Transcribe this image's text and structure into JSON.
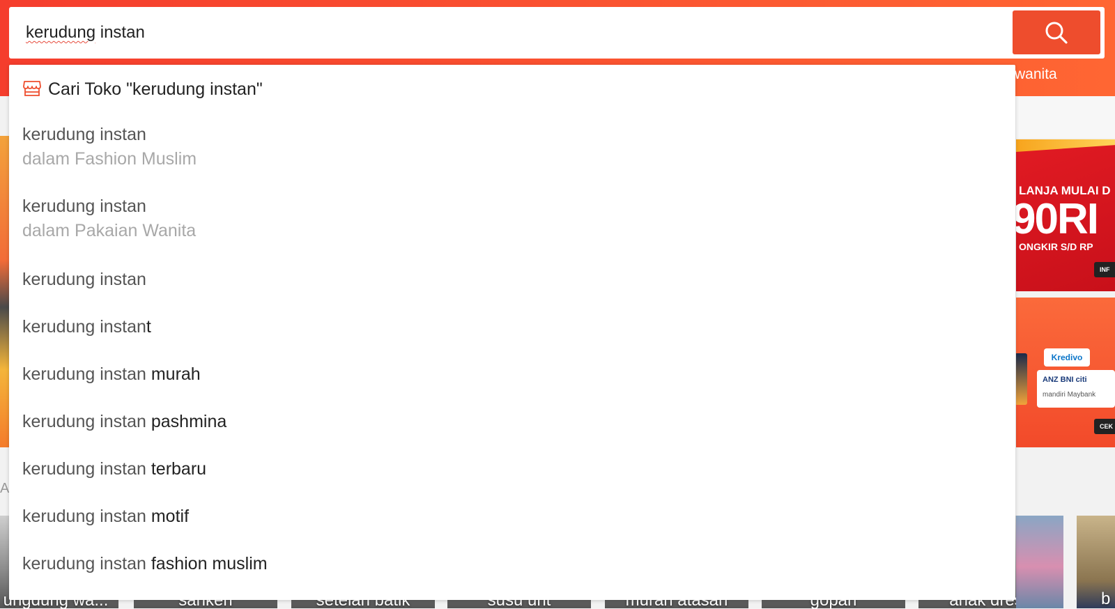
{
  "search": {
    "value": "kerudung instan",
    "value_underlined": "kerudung",
    "value_rest": " instan"
  },
  "header": {
    "hint_text": "wanita"
  },
  "dropdown": {
    "shop_search_label": "Cari Toko \"kerudung instan\"",
    "category_suggestions": [
      {
        "query": "kerudung instan",
        "category": "dalam Fashion Muslim"
      },
      {
        "query": "kerudung instan",
        "category": "dalam Pakaian Wanita"
      }
    ],
    "suggestions": [
      {
        "query": "kerudung instan",
        "completion": ""
      },
      {
        "query": "kerudung instan",
        "completion": "t"
      },
      {
        "query": "kerudung instan",
        "completion": " murah"
      },
      {
        "query": "kerudung instan",
        "completion": " pashmina"
      },
      {
        "query": "kerudung instan",
        "completion": " terbaru"
      },
      {
        "query": "kerudung instan",
        "completion": " motif"
      },
      {
        "query": "kerudung instan",
        "completion": " fashion muslim"
      }
    ]
  },
  "background": {
    "promo": {
      "line1": "LANJA MULAI D",
      "big": "90RI",
      "line2": "ONGKIR S/D RP",
      "chip": "INF"
    },
    "payment": {
      "kredivo": "Kredivo",
      "banks_row1": "ANZ  BNI  citi",
      "banks_row2": "mandiri  Maybank",
      "chip": "CEK"
    },
    "left_letter": "Al",
    "tiles": [
      "ungdung wa...",
      "sanken",
      "setelan batik",
      "susu unt",
      "murah atasan",
      "gopan",
      "anak dress",
      "b"
    ]
  },
  "colors": {
    "brand": "#ee4d2d",
    "header_gradient_start": "#f53d2d",
    "header_gradient_end": "#ff6633"
  },
  "icons": {
    "search_button": "search-icon",
    "shop": "shop-icon"
  }
}
